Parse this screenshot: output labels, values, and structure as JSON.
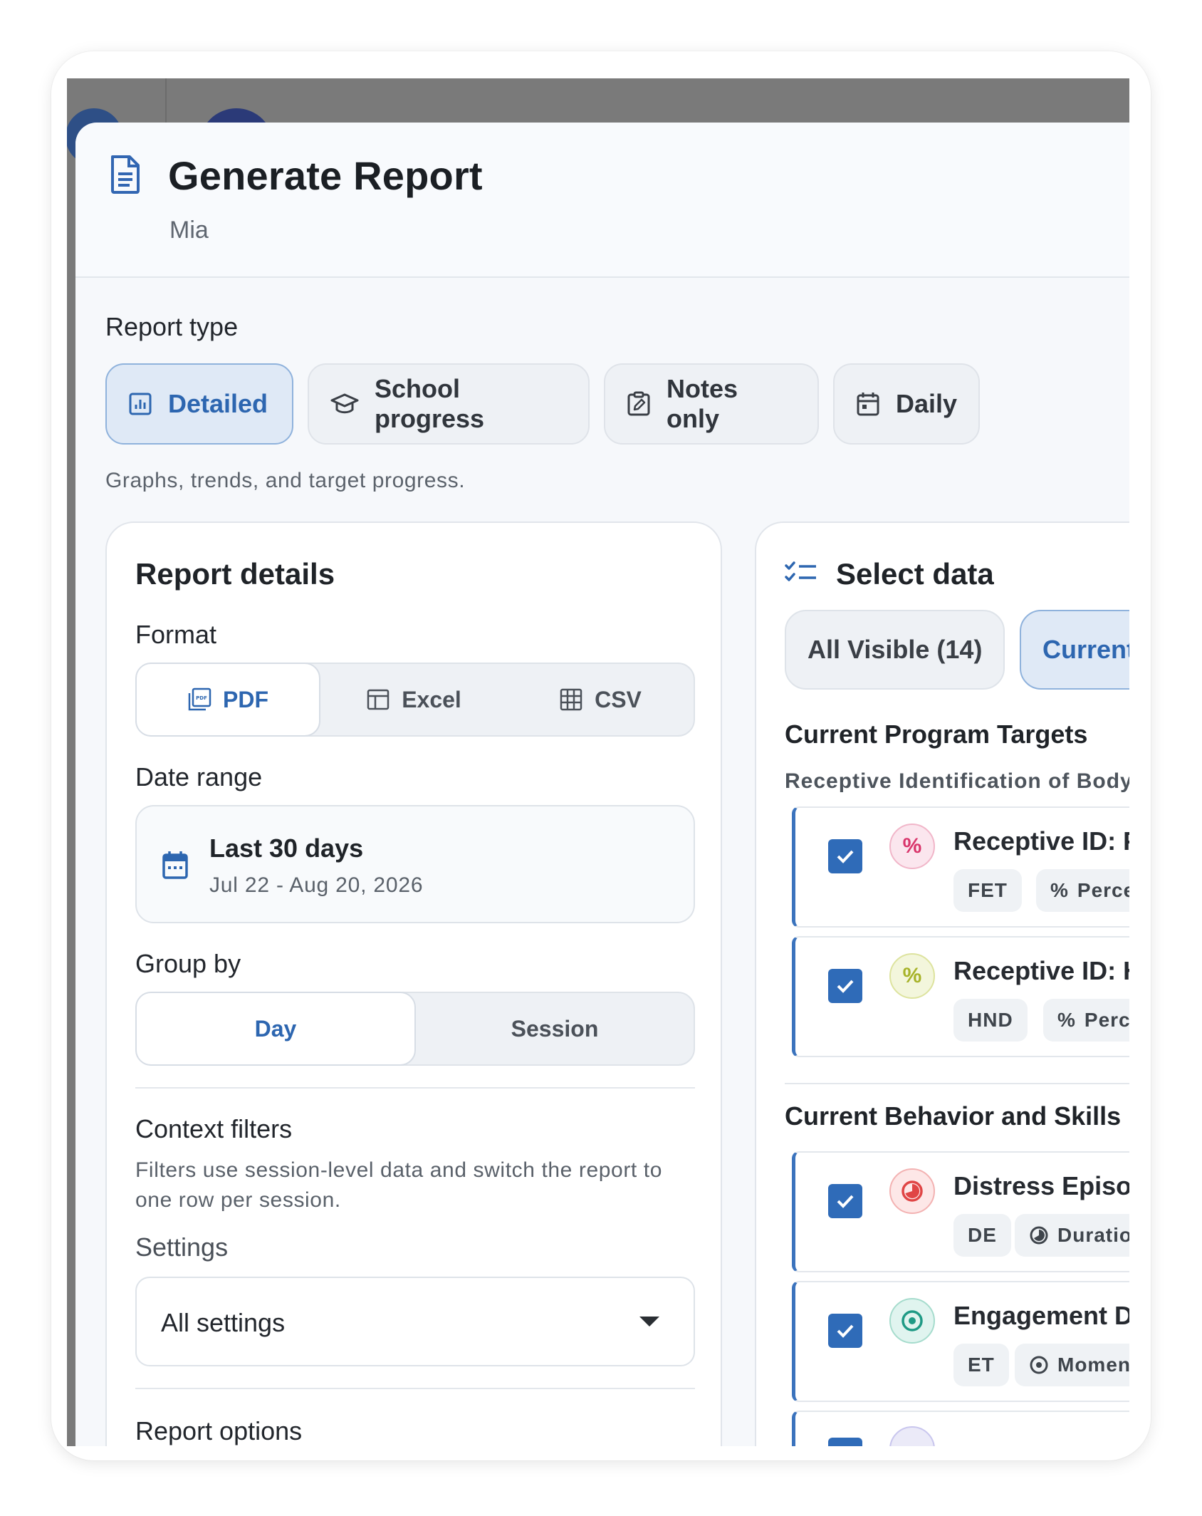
{
  "dialog": {
    "title": "Generate Report",
    "subtitle": "Mia"
  },
  "report_type": {
    "label": "Report type",
    "options": [
      {
        "label": "Detailed",
        "icon": "bar-chart-icon",
        "active": true
      },
      {
        "label": "School progress",
        "icon": "graduation-cap-icon",
        "active": false
      },
      {
        "label": "Notes only",
        "icon": "clipboard-edit-icon",
        "active": false
      },
      {
        "label": "Daily",
        "icon": "calendar-icon",
        "active": false
      }
    ],
    "hint": "Graphs, trends, and target progress."
  },
  "report_details": {
    "title": "Report details",
    "format": {
      "label": "Format",
      "options": [
        {
          "label": "PDF",
          "icon": "pdf-icon",
          "active": true
        },
        {
          "label": "Excel",
          "icon": "table-icon",
          "active": false
        },
        {
          "label": "CSV",
          "icon": "grid-icon",
          "active": false
        }
      ]
    },
    "date_range": {
      "label": "Date range",
      "value": "Last 30 days",
      "dates": "Jul 22 - Aug 20, 2026"
    },
    "group_by": {
      "label": "Group by",
      "options": [
        {
          "label": "Day",
          "active": true
        },
        {
          "label": "Session",
          "active": false
        }
      ]
    },
    "context_filters": {
      "label": "Context filters",
      "description": "Filters use session-level data and switch the report to one row per session."
    },
    "settings": {
      "label": "Settings",
      "value": "All settings"
    },
    "report_options": {
      "label": "Report options"
    }
  },
  "select_data": {
    "title": "Select data",
    "filters": [
      {
        "label": "All Visible (14)",
        "active": false
      },
      {
        "label": "Current",
        "active": true
      }
    ],
    "program_section": {
      "title": "Current Program Targets",
      "subtitle": "Receptive Identification of Body",
      "items": [
        {
          "name": "Receptive ID: F",
          "code": "FET",
          "measure": "Perce",
          "measure_symbol": "%",
          "icon_symbol": "%",
          "icon_color": "#d9356b",
          "icon_bg": "#fbe6ee",
          "checked": true
        },
        {
          "name": "Receptive ID: H",
          "code": "HND",
          "measure": "Perce",
          "measure_symbol": "%",
          "icon_symbol": "%",
          "icon_color": "#a7b329",
          "icon_bg": "#f3f6dc",
          "checked": true
        }
      ]
    },
    "behavior_section": {
      "title": "Current Behavior and Skills",
      "items": [
        {
          "name": "Distress Episod",
          "code": "DE",
          "measure": "Duratio",
          "icon_color": "#e04545",
          "icon_bg": "#fde7e7",
          "checked": true
        },
        {
          "name": "Engagement Du",
          "code": "ET",
          "measure": "Momen",
          "icon_color": "#1f9a85",
          "icon_bg": "#e0f4ef",
          "checked": true
        }
      ]
    }
  },
  "colors": {
    "accent": "#2d66b0",
    "checkbox": "#2f6bb8"
  }
}
